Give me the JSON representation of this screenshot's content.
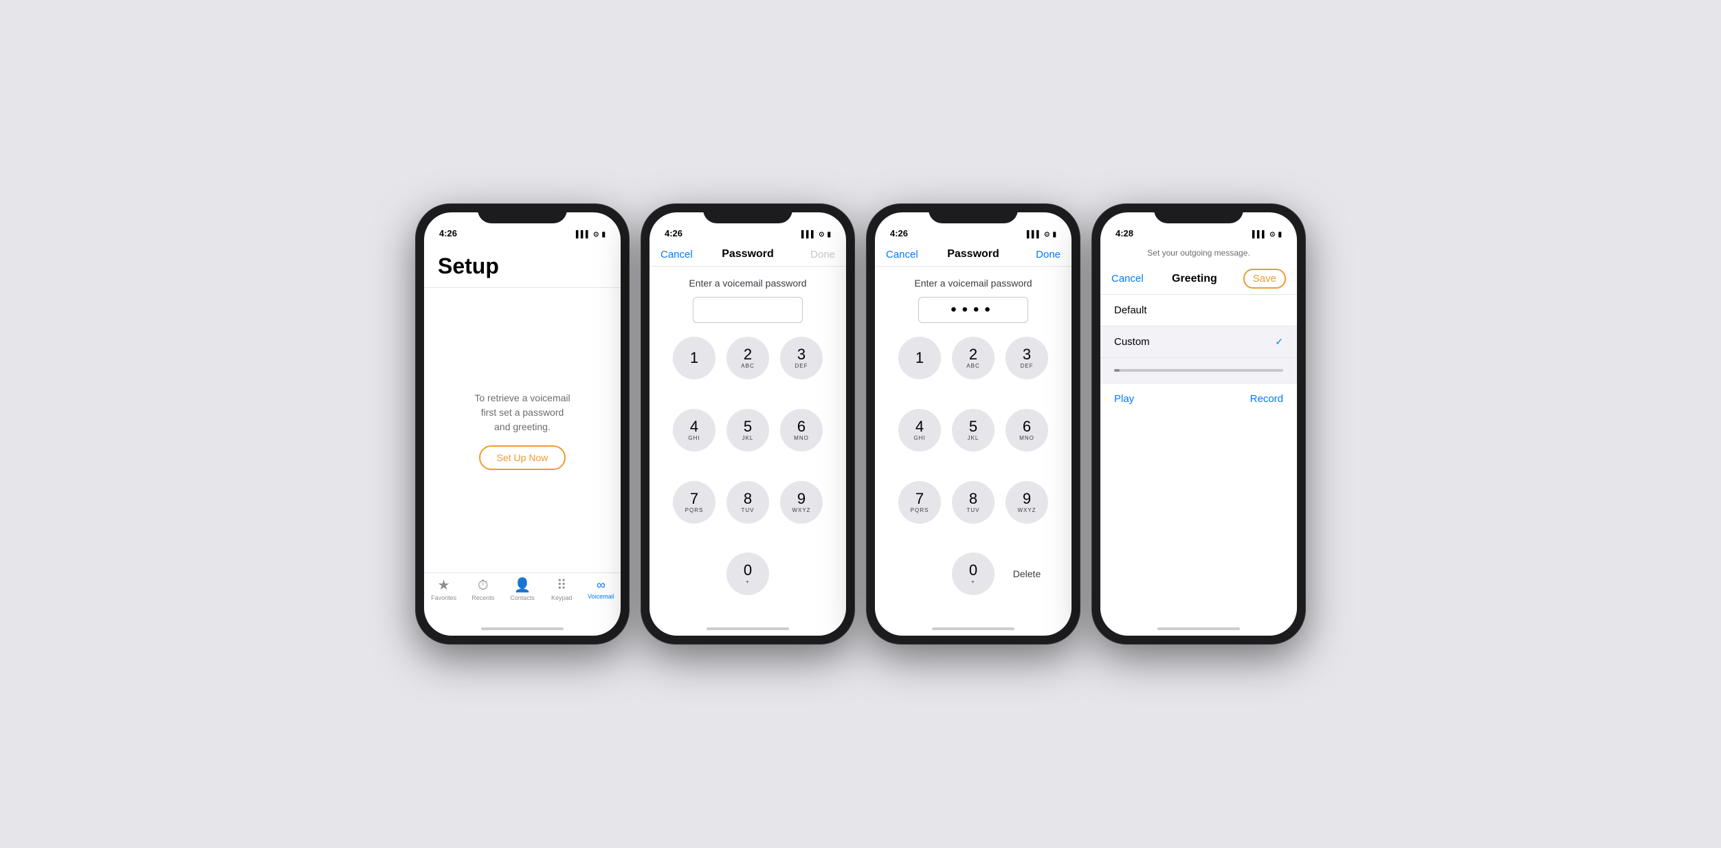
{
  "phones": [
    {
      "id": "phone1",
      "statusBar": {
        "time": "4:26",
        "arrow": "↗",
        "signal": "▌▌▌",
        "wifi": "WiFi",
        "battery": "▮"
      },
      "screen": "setup",
      "setupTitle": "Setup",
      "setupText": "To retrieve a voicemail\nfirst set a password\nand greeting.",
      "setupBtnLabel": "Set Up Now",
      "tabBar": [
        {
          "icon": "★",
          "label": "Favorites",
          "active": false
        },
        {
          "icon": "🕐",
          "label": "Recents",
          "active": false
        },
        {
          "icon": "👤",
          "label": "Contacts",
          "active": false
        },
        {
          "icon": "⠿",
          "label": "Keypad",
          "active": false
        },
        {
          "icon": "∞",
          "label": "Voicemail",
          "active": true
        }
      ]
    },
    {
      "id": "phone2",
      "statusBar": {
        "time": "4:26",
        "arrow": "↗",
        "signal": "▌▌▌",
        "wifi": "WiFi",
        "battery": "▮"
      },
      "screen": "password-empty",
      "navCancel": "Cancel",
      "navTitle": "Password",
      "navDone": "Done",
      "navDoneDisabled": true,
      "pwLabel": "Enter a voicemail password",
      "pwValue": "",
      "keys": [
        {
          "num": "1",
          "letters": ""
        },
        {
          "num": "2",
          "letters": "ABC"
        },
        {
          "num": "3",
          "letters": "DEF"
        },
        {
          "num": "4",
          "letters": "GHI"
        },
        {
          "num": "5",
          "letters": "JKL"
        },
        {
          "num": "6",
          "letters": "MNO"
        },
        {
          "num": "7",
          "letters": "PQRS"
        },
        {
          "num": "8",
          "letters": "TUV"
        },
        {
          "num": "9",
          "letters": "WXYZ"
        },
        {
          "num": "0",
          "letters": "+"
        }
      ]
    },
    {
      "id": "phone3",
      "statusBar": {
        "time": "4:26",
        "arrow": "↗",
        "signal": "▌▌▌",
        "wifi": "WiFi",
        "battery": "▮"
      },
      "screen": "password-filled",
      "navCancel": "Cancel",
      "navTitle": "Password",
      "navDone": "Done",
      "navDoneDisabled": false,
      "pwLabel": "Enter a voicemail password",
      "pwDots": "••••",
      "deleteLabel": "Delete",
      "keys": [
        {
          "num": "1",
          "letters": ""
        },
        {
          "num": "2",
          "letters": "ABC"
        },
        {
          "num": "3",
          "letters": "DEF"
        },
        {
          "num": "4",
          "letters": "GHI"
        },
        {
          "num": "5",
          "letters": "JKL"
        },
        {
          "num": "6",
          "letters": "MNO"
        },
        {
          "num": "7",
          "letters": "PQRS"
        },
        {
          "num": "8",
          "letters": "TUV"
        },
        {
          "num": "9",
          "letters": "WXYZ"
        },
        {
          "num": "0",
          "letters": "+"
        }
      ]
    },
    {
      "id": "phone4",
      "statusBar": {
        "time": "4:28",
        "arrow": "↗",
        "signal": "▌▌▌",
        "wifi": "WiFi",
        "battery": "▮"
      },
      "screen": "greeting",
      "greetingSubtitle": "Set your outgoing message.",
      "navCancel": "Cancel",
      "navTitle": "Greeting",
      "navSave": "Save",
      "greetingRows": [
        {
          "label": "Default",
          "selected": false
        },
        {
          "label": "Custom",
          "selected": true
        }
      ],
      "playLabel": "Play",
      "recordLabel": "Record"
    }
  ],
  "colors": {
    "accent": "#007aff",
    "orange": "#f09a30",
    "tabActive": "#007aff",
    "tabInactive": "#8e8e93"
  }
}
